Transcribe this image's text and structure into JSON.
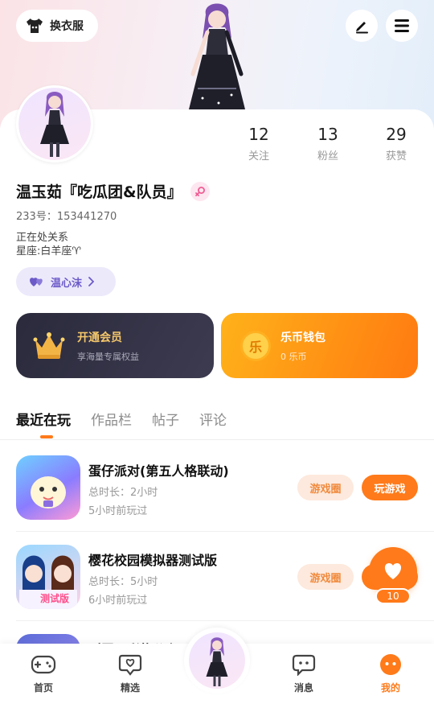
{
  "header": {
    "dress_label": "换衣服",
    "edit_icon": "pen-icon",
    "menu_icon": "menu-icon"
  },
  "profile": {
    "stats": [
      {
        "value": "12",
        "label": "关注"
      },
      {
        "value": "13",
        "label": "粉丝"
      },
      {
        "value": "29",
        "label": "获赞"
      }
    ],
    "name": "温玉茹『吃瓜团&队员』",
    "uid_label": "233号：",
    "uid_value": "153441270",
    "bio_line1": "正在处关系",
    "bio_line2": "星座:白羊座♈",
    "tag_label": "温心沫"
  },
  "promos": {
    "vip_title": "开通会员",
    "vip_sub": "享海量专属权益",
    "wallet_title": "乐币钱包",
    "wallet_sub": "0 乐币",
    "wallet_coin": "乐"
  },
  "tabs": [
    "最近在玩",
    "作品栏",
    "帖子",
    "评论"
  ],
  "games": [
    {
      "title": "蛋仔派对(第五人格联动)",
      "duration": "总时长：2小时",
      "last_played": "5小时前玩过",
      "circle_label": "游戏圈",
      "play_label": "玩游戏"
    },
    {
      "title": "樱花校园模拟器测试版",
      "duration": "总时长：5小时",
      "last_played": "6小时前玩过",
      "circle_label": "游戏圈",
      "icon_badge": "测试版"
    },
    {
      "title": "叫罗三彩牧公主"
    }
  ],
  "fab": {
    "count": "10"
  },
  "bottom_nav": [
    {
      "label": "首页",
      "icon": "gamepad-icon"
    },
    {
      "label": "精选",
      "icon": "heart-chat-icon"
    },
    {
      "label": "消息",
      "icon": "message-icon"
    },
    {
      "label": "我的",
      "icon": "profile-face-icon"
    }
  ],
  "colors": {
    "accent": "#ff7a1a",
    "tag": "#6c5ac8",
    "vip_bg": "#2a2a3c"
  }
}
